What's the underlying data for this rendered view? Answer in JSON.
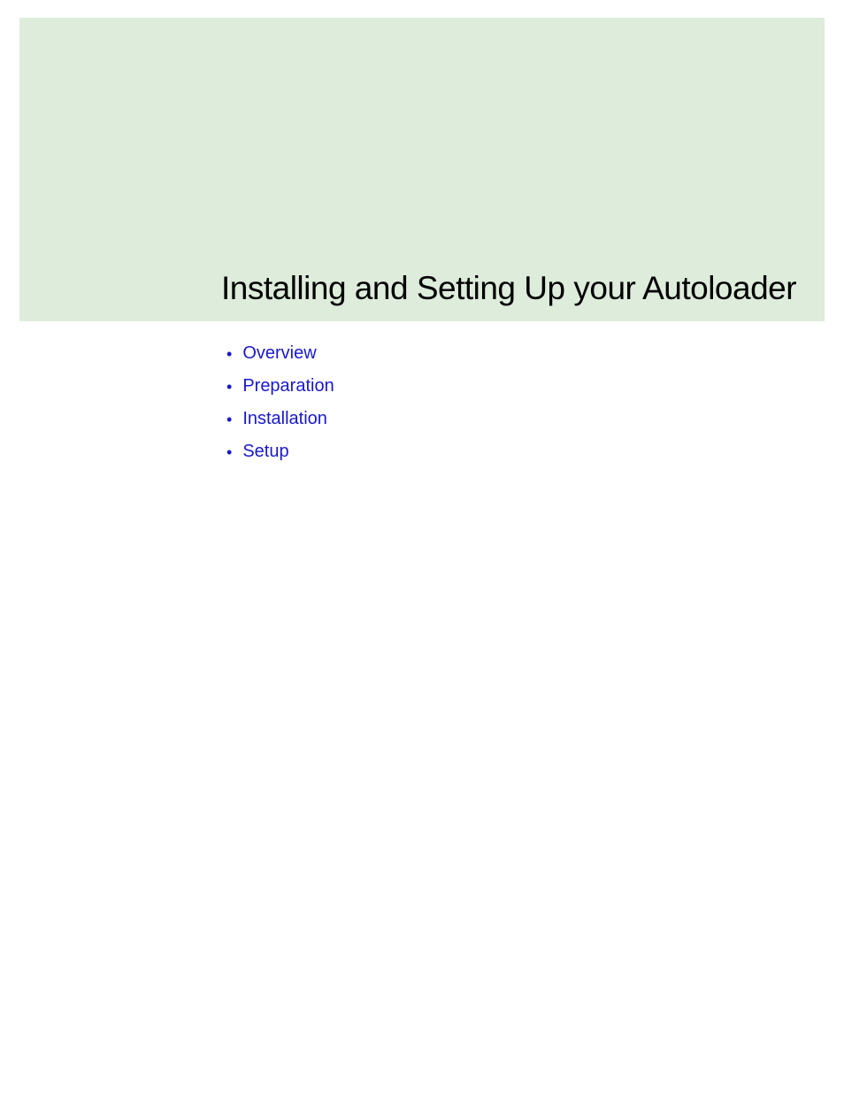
{
  "title": "Installing and Setting Up your Autoloader",
  "toc": {
    "items": [
      {
        "label": "Overview"
      },
      {
        "label": "Preparation"
      },
      {
        "label": "Installation"
      },
      {
        "label": "Setup"
      }
    ]
  }
}
